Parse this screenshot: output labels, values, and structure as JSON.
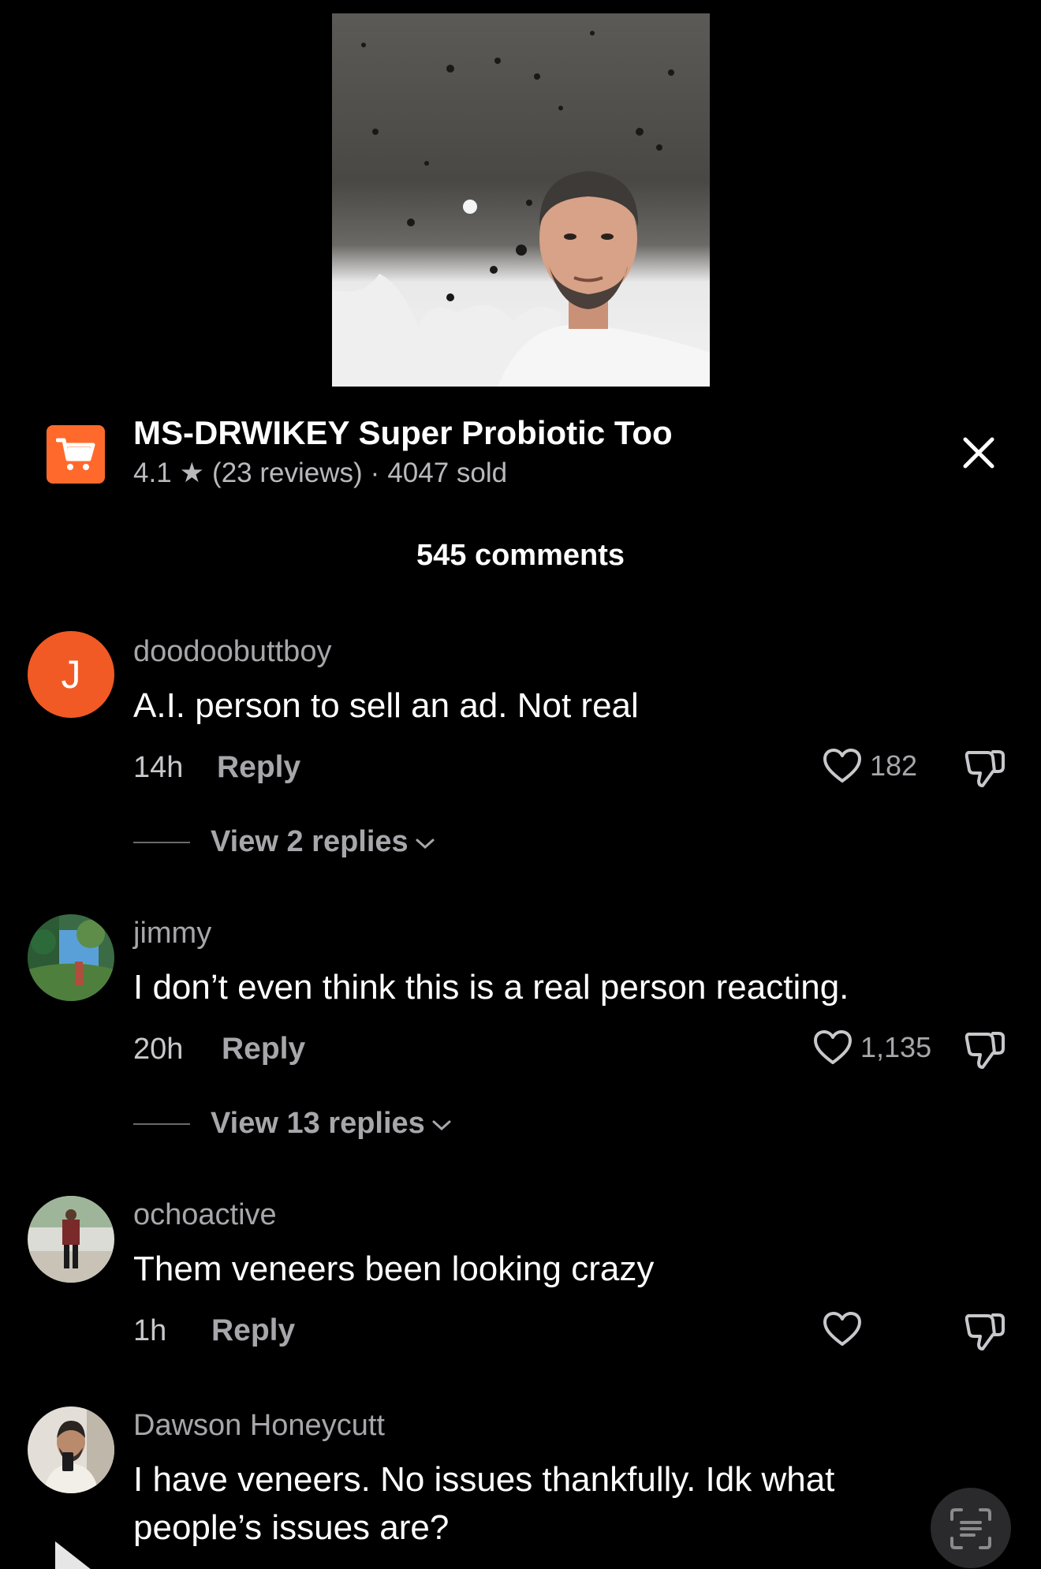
{
  "product": {
    "title": "MS-DRWIKEY Super Probiotic Too",
    "rating": "4.1",
    "star": "★",
    "reviews": "(23 reviews)",
    "separator": "·",
    "sold": "4047 sold",
    "accent_color": "#ff6a2c"
  },
  "comments_header": "545 comments",
  "comments": [
    {
      "username": "doodoobuttboy",
      "avatar_letter": "J",
      "text": "A.I. person to sell an ad. Not real",
      "time": "14h",
      "reply_label": "Reply",
      "likes": "182",
      "view_replies": "View 2 replies"
    },
    {
      "username": "jimmy",
      "text": "I don’t even think this is a real person reacting.",
      "time": "20h",
      "reply_label": "Reply",
      "likes": "1,135",
      "view_replies": "View 13 replies"
    },
    {
      "username": "ochoactive",
      "text": "Them veneers been looking crazy",
      "time": "1h",
      "reply_label": "Reply",
      "likes": ""
    },
    {
      "username": "Dawson Honeycutt",
      "text": "I have veneers. No issues thankfully. Idk what people’s issues are?"
    }
  ],
  "icons": {
    "cart": "cart-icon",
    "close": "close-icon",
    "heart": "heart-icon",
    "dislike": "thumbs-down-icon",
    "chevron": "chevron-down-icon",
    "play": "play-icon",
    "scan": "scan-text-icon"
  }
}
